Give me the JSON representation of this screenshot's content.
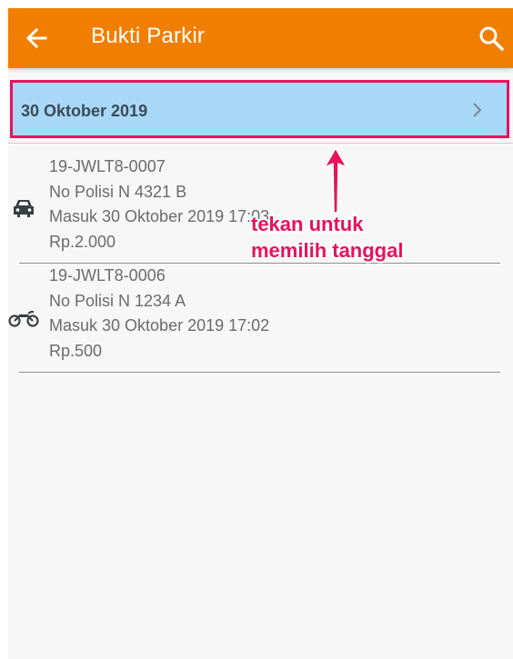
{
  "appbar": {
    "title": "Bukti Parkir",
    "back_icon": "arrow-left-icon",
    "search_icon": "search-icon",
    "color": "#f07f00"
  },
  "date_selector": {
    "label": "30 Oktober 2019",
    "chevron_icon": "chevron-right-icon",
    "highlight_color": "#e8125d",
    "background": "#a8d8f8"
  },
  "tickets": [
    {
      "vehicle_icon": "car-icon",
      "code": "19-JWLT8-0007",
      "plate": "No Polisi N 4321 B",
      "entry": "Masuk 30 Oktober 2019 17:03",
      "fee": "Rp.2.000"
    },
    {
      "vehicle_icon": "motorcycle-icon",
      "code": "19-JWLT8-0006",
      "plate": "No Polisi N 1234 A",
      "entry": "Masuk 30 Oktober 2019 17:02",
      "fee": "Rp.500"
    }
  ],
  "annotation": {
    "line1": "tekan untuk",
    "line2": "memilih tanggal",
    "color": "#e8125d"
  }
}
